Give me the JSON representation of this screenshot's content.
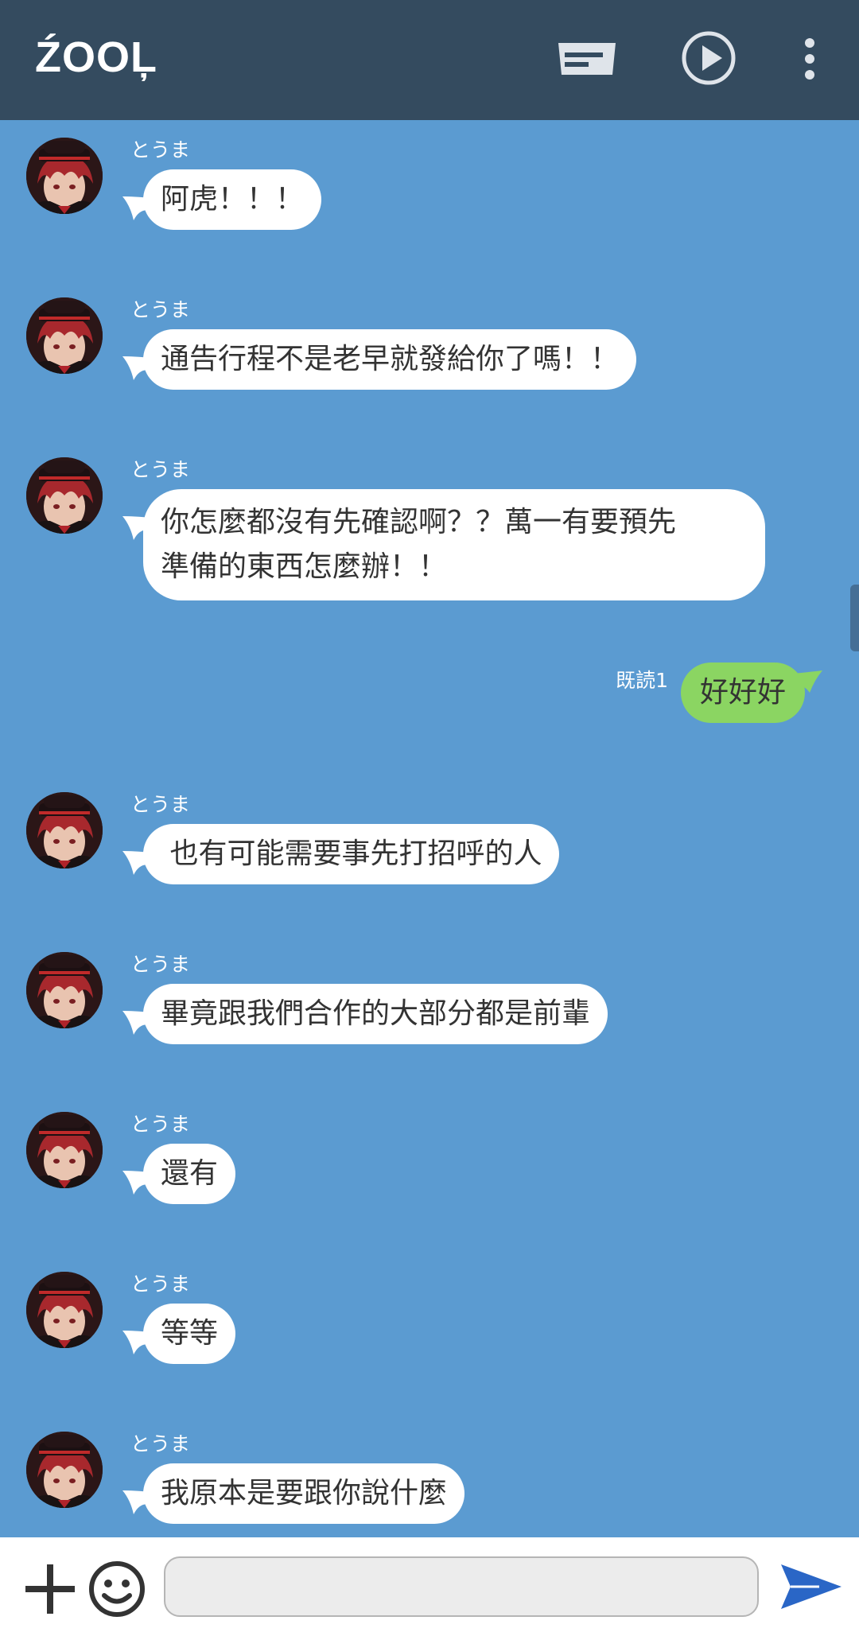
{
  "header": {
    "title": "ŹOOĻ",
    "icons": [
      "message-box-icon",
      "play-circle-icon",
      "more-vert-icon"
    ]
  },
  "messages": [
    {
      "sender": "とうま",
      "text": "阿虎！！！"
    },
    {
      "sender": "とうま",
      "text": "通告行程不是老早就發給你了嗎！！"
    },
    {
      "sender": "とうま",
      "text_lines": [
        "你怎麼都沒有先確認啊？？萬一有要預先",
        "準備的東西怎麼辦！！"
      ]
    },
    {
      "sender": "me",
      "text": "好好好",
      "read_label": "既読1"
    },
    {
      "sender": "とうま",
      "text": " 也有可能需要事先打招呼的人"
    },
    {
      "sender": "とうま",
      "text": "畢竟跟我們合作的大部分都是前輩"
    },
    {
      "sender": "とうま",
      "text": "還有"
    },
    {
      "sender": "とうま",
      "text": "等等"
    },
    {
      "sender": "とうま",
      "text": "我原本是要跟你說什麼"
    }
  ],
  "composer": {
    "value": "",
    "icons": [
      "plus-icon",
      "emoji-icon",
      "send-icon"
    ]
  },
  "colors": {
    "header": "#344b5f",
    "chat_bg": "#5b9bd1",
    "my_bubble": "#8bd562",
    "send": "#2a66c6"
  }
}
